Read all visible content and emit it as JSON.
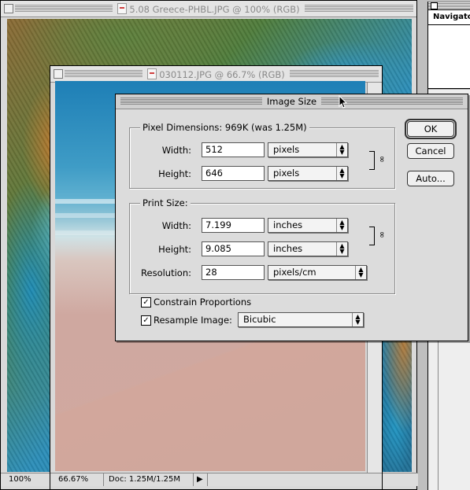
{
  "windows": {
    "back": {
      "title": "5.08 Greece-PHBL.JPG @ 100% (RGB)",
      "status_zoom": "100%"
    },
    "front": {
      "title": "030112.JPG @ 66.7% (RGB)",
      "status_zoom": "66.67%",
      "status_doc": "Doc: 1.25M/1.25M",
      "status_arrow": "▶"
    },
    "navigator": {
      "title": "Navigator"
    }
  },
  "dialog": {
    "title": "Image Size",
    "pixel_dimensions": {
      "label": "Pixel Dimensions:",
      "size": "969K (was 1.25M)",
      "width_label": "Width:",
      "width_value": "512",
      "width_unit": "pixels",
      "height_label": "Height:",
      "height_value": "646",
      "height_unit": "pixels"
    },
    "print_size": {
      "label": "Print Size:",
      "width_label": "Width:",
      "width_value": "7.199",
      "width_unit": "inches",
      "height_label": "Height:",
      "height_value": "9.085",
      "height_unit": "inches",
      "resolution_label": "Resolution:",
      "resolution_value": "28",
      "resolution_unit": "pixels/cm"
    },
    "constrain": {
      "label": "Constrain Proportions",
      "checked": true,
      "mark": "✓"
    },
    "resample": {
      "label": "Resample Image:",
      "checked": true,
      "mark": "✓",
      "method": "Bicubic"
    },
    "buttons": {
      "ok": "OK",
      "cancel": "Cancel",
      "auto": "Auto..."
    },
    "chain_glyph": "∞"
  }
}
